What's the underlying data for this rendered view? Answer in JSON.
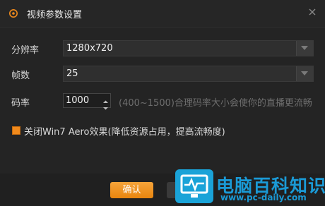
{
  "window": {
    "title": "视频参数设置",
    "icon": "settings-target-icon",
    "close_icon": "close-icon"
  },
  "fields": {
    "resolution": {
      "label": "分辨率",
      "value": "1280x720"
    },
    "framerate": {
      "label": "帧数",
      "value": "25"
    },
    "bitrate": {
      "label": "码率",
      "value": "1000",
      "hint": "(400~1500)合理码率大小会使你的直播更流畅"
    }
  },
  "aero": {
    "label": "关闭Win7 Aero效果(降低资源占用，提高流畅度)",
    "checked": true
  },
  "buttons": {
    "ok": "确认"
  },
  "watermark": {
    "text": "电脑百科知识",
    "url": "www.pc-daily.com"
  },
  "colors": {
    "accent": "#f08a1c",
    "watermark": "#1a9ad6"
  }
}
